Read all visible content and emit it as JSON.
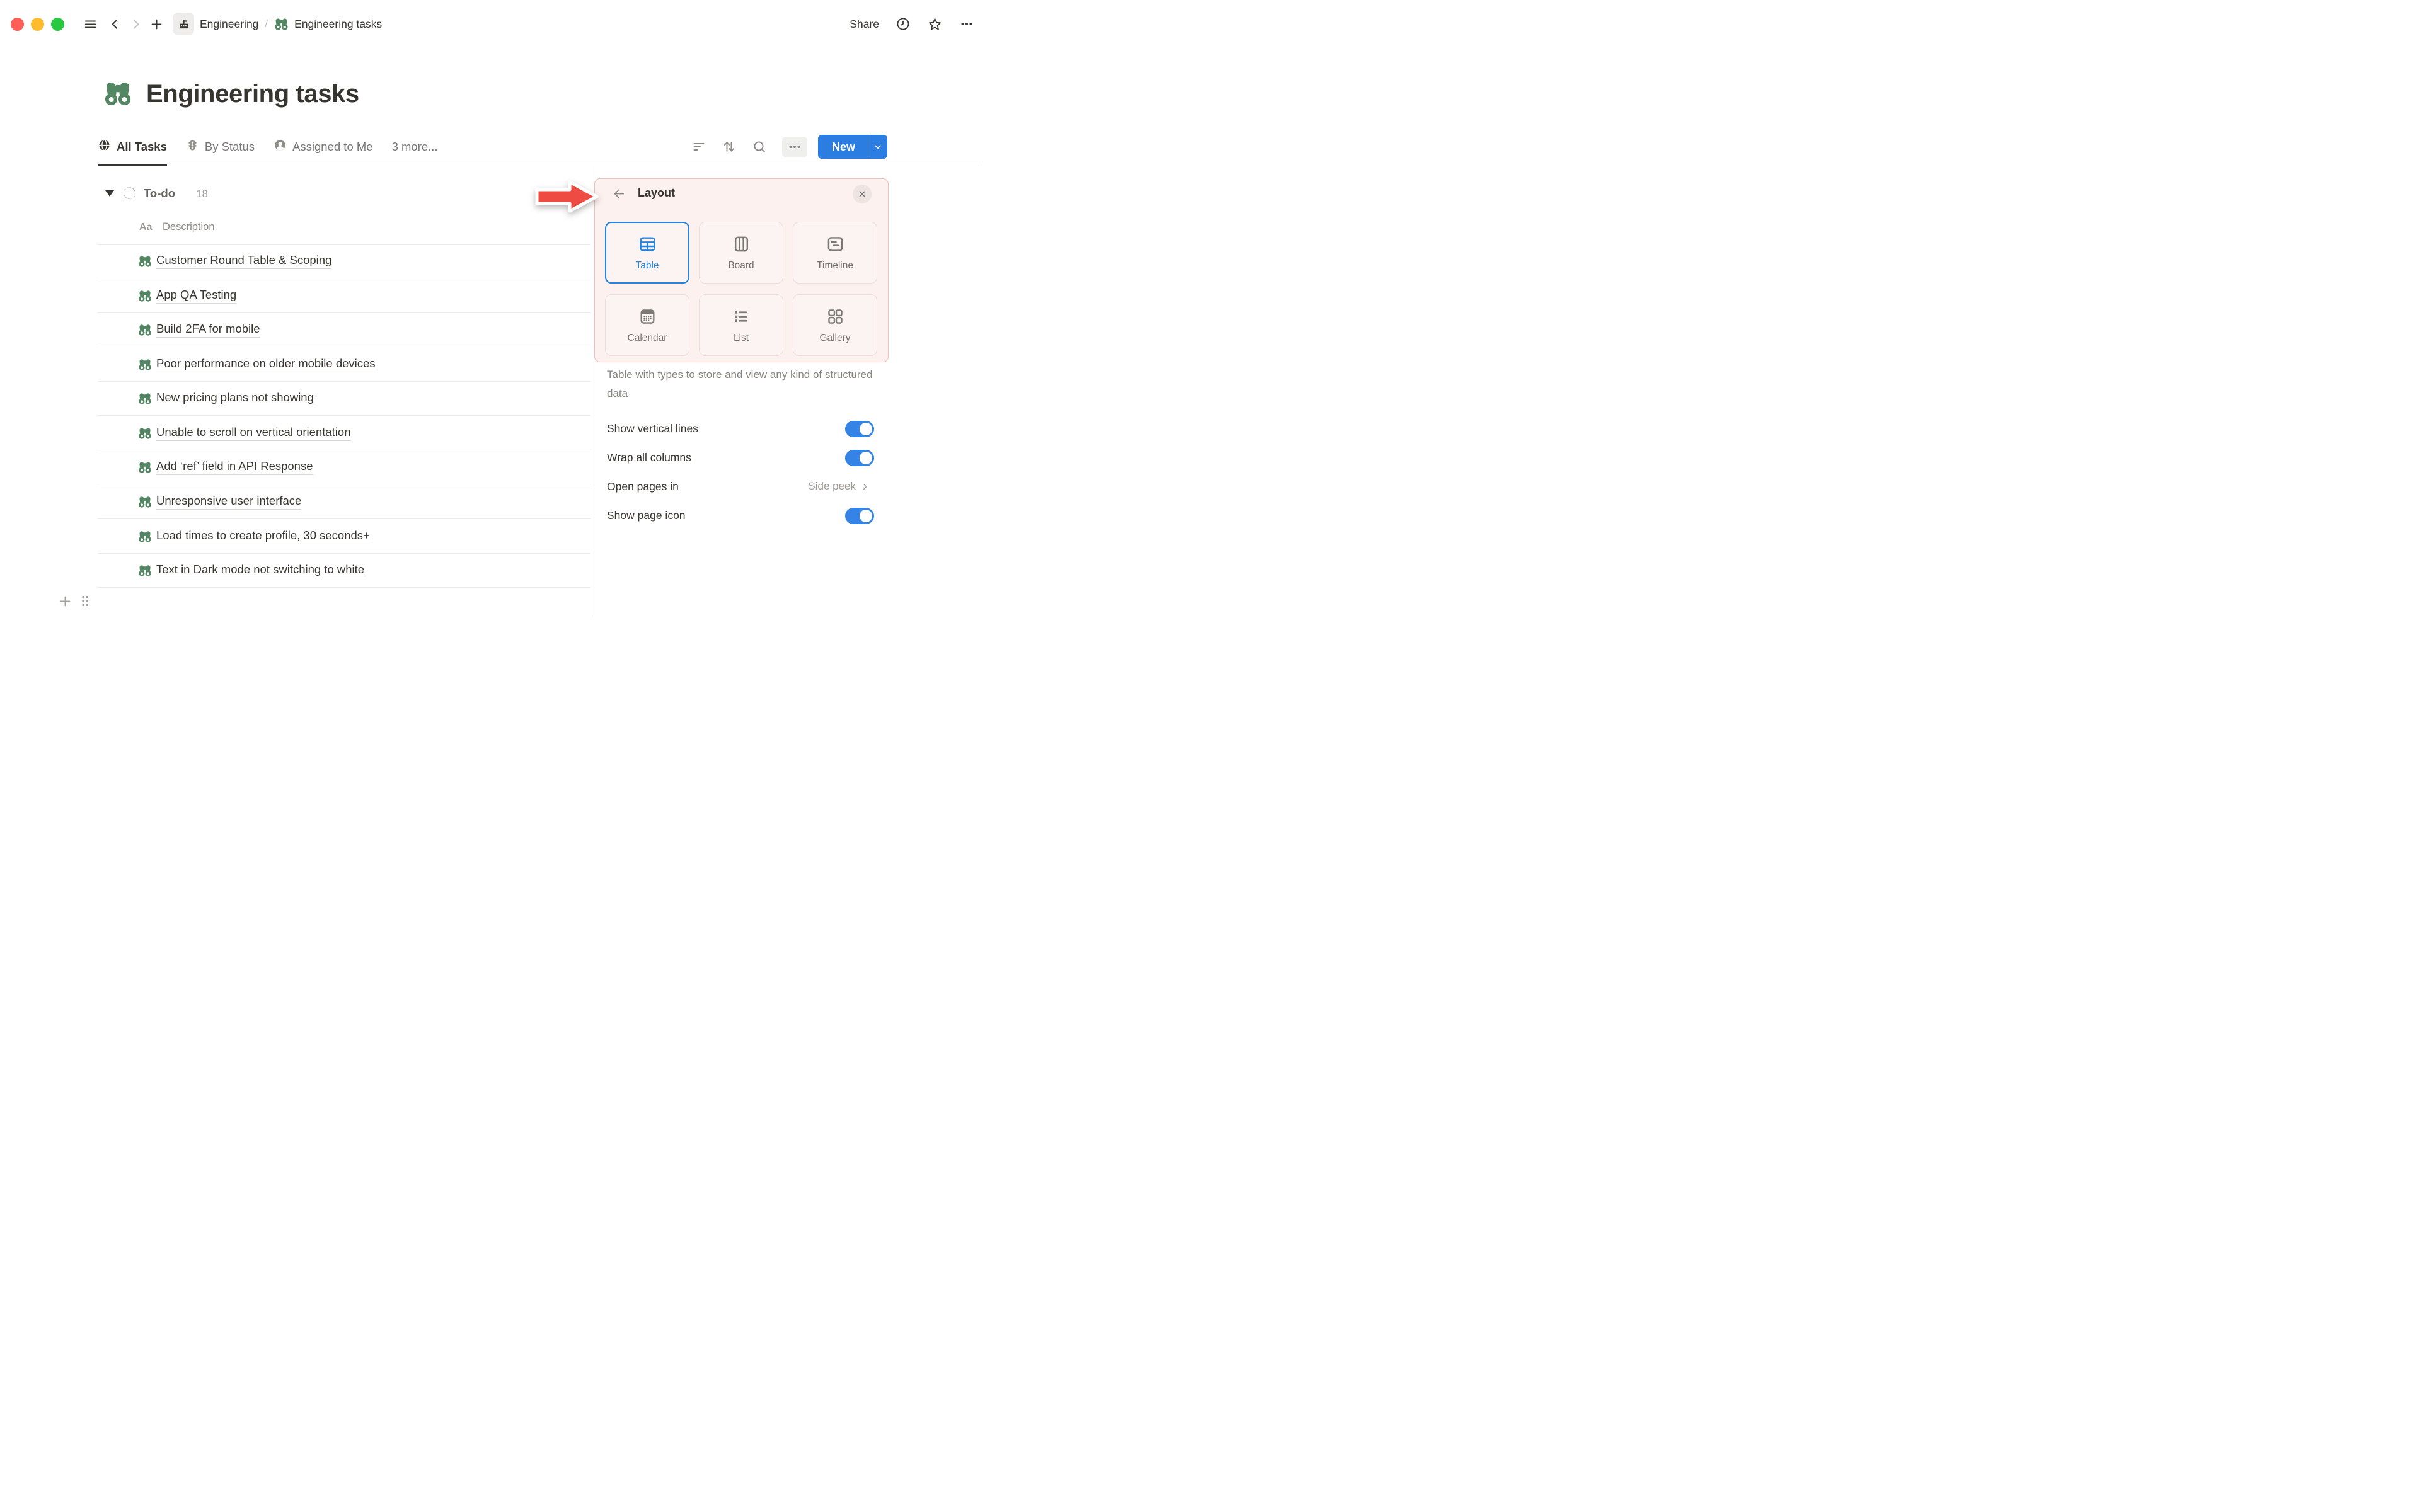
{
  "titlebar": {
    "breadcrumb": {
      "workspace": "Engineering",
      "separator": "/",
      "page": "Engineering tasks"
    },
    "share_label": "Share"
  },
  "page": {
    "title": "Engineering tasks"
  },
  "tabs": [
    {
      "label": "All Tasks",
      "icon": "globe-icon",
      "active": true
    },
    {
      "label": "By Status",
      "icon": "status-traffic-light-icon",
      "active": false
    },
    {
      "label": "Assigned to Me",
      "icon": "person-icon",
      "active": false
    },
    {
      "label": "3 more...",
      "icon": "",
      "active": false
    }
  ],
  "toolbar": {
    "new_label": "New"
  },
  "table": {
    "group": {
      "name": "To-do",
      "count": "18"
    },
    "column_type_glyph": "Aa",
    "column_header": "Description",
    "tasks": [
      "Customer Round Table & Scoping",
      "App QA Testing",
      "Build 2FA for mobile",
      "Poor performance on older mobile devices",
      "New pricing plans not showing",
      "Unable to scroll on vertical orientation",
      "Add ‘ref’ field in API Response",
      "Unresponsive user interface",
      "Load times to create profile, 30 seconds+",
      "Text in Dark mode not switching to white"
    ]
  },
  "panel": {
    "title": "Layout",
    "options": [
      {
        "label": "Table",
        "icon": "table-layout-icon",
        "selected": true
      },
      {
        "label": "Board",
        "icon": "board-layout-icon",
        "selected": false
      },
      {
        "label": "Timeline",
        "icon": "timeline-layout-icon",
        "selected": false
      },
      {
        "label": "Calendar",
        "icon": "calendar-layout-icon",
        "selected": false
      },
      {
        "label": "List",
        "icon": "list-layout-icon",
        "selected": false
      },
      {
        "label": "Gallery",
        "icon": "gallery-layout-icon",
        "selected": false
      }
    ],
    "description": "Table with types to store and view any kind of structured data",
    "settings": [
      {
        "label": "Show vertical lines",
        "type": "toggle",
        "value": true
      },
      {
        "label": "Wrap all columns",
        "type": "toggle",
        "value": true
      },
      {
        "label": "Open pages in",
        "type": "value",
        "value": "Side peek"
      },
      {
        "label": "Show page icon",
        "type": "toggle",
        "value": true
      }
    ]
  },
  "colors": {
    "accent_blue": "#2383e2",
    "notion_green": "#538663",
    "annotation_red": "#ee4b42",
    "highlight_pink": "#fdf1ef",
    "text_dark": "#37352f",
    "text_gray": "#787774"
  }
}
